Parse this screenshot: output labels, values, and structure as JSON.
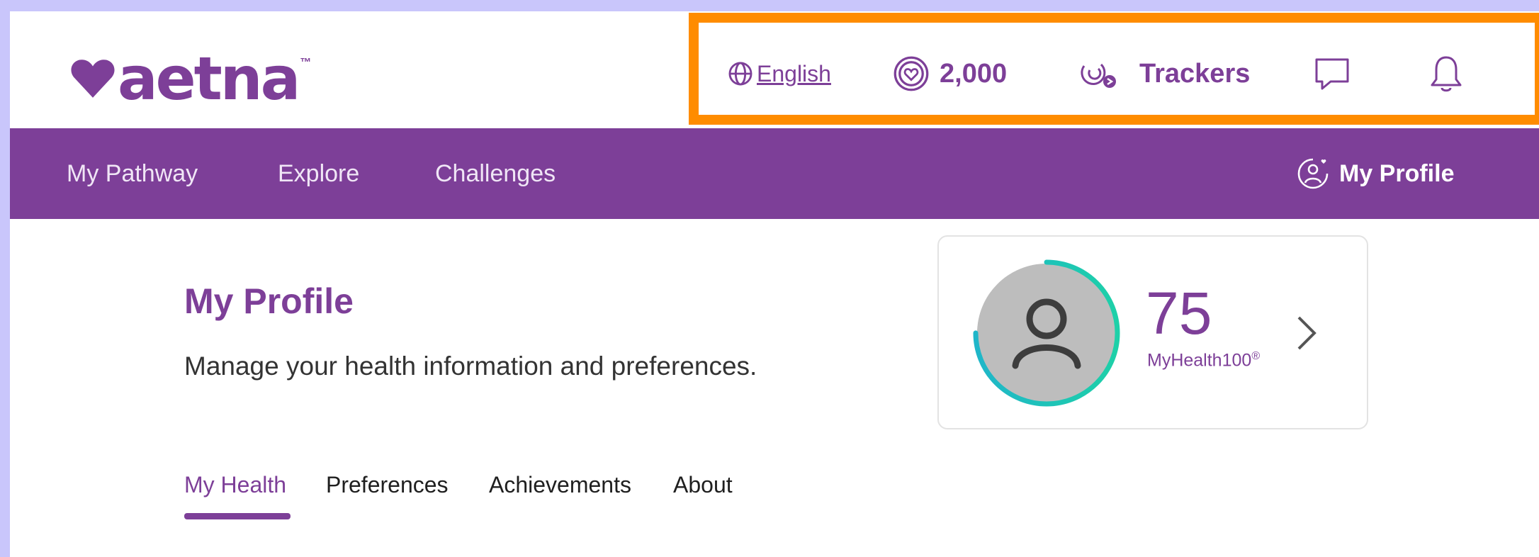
{
  "brand": {
    "logo_text": "aetna",
    "trademark": "™",
    "color": "#7d3f98"
  },
  "header": {
    "language": "English",
    "points": "2,000",
    "trackers_label": "Trackers",
    "icons": [
      "globe-icon",
      "points-heart-icon",
      "trackers-icon",
      "chat-icon",
      "bell-icon"
    ],
    "highlight_color": "#ff8c00"
  },
  "nav": {
    "items": [
      {
        "label": "My Pathway"
      },
      {
        "label": "Explore"
      },
      {
        "label": "Challenges"
      }
    ],
    "profile_label": "My Profile"
  },
  "main": {
    "title": "My Profile",
    "subtitle": "Manage your health information and preferences.",
    "score": {
      "value": "75",
      "label": "MyHealth100",
      "label_mark": "®",
      "progress_fraction": 0.75
    },
    "tabs": [
      {
        "label": "My Health",
        "active": true
      },
      {
        "label": "Preferences",
        "active": false
      },
      {
        "label": "Achievements",
        "active": false
      },
      {
        "label": "About",
        "active": false
      }
    ]
  }
}
